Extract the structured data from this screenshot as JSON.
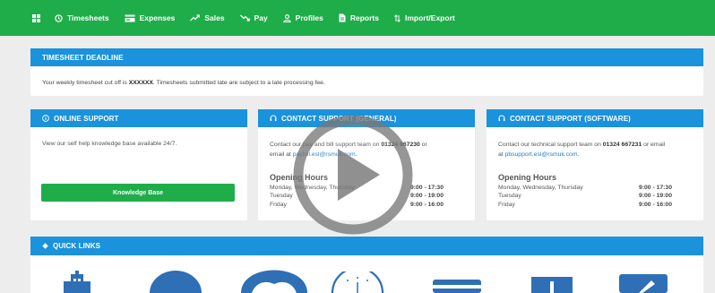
{
  "nav": {
    "items": [
      {
        "label": "Timesheets",
        "icon": "clock-icon"
      },
      {
        "label": "Expenses",
        "icon": "card-icon"
      },
      {
        "label": "Sales",
        "icon": "trend-up-icon"
      },
      {
        "label": "Pay",
        "icon": "trend-down-icon"
      },
      {
        "label": "Profiles",
        "icon": "person-icon"
      },
      {
        "label": "Reports",
        "icon": "document-icon"
      },
      {
        "label": "Import/Export",
        "icon": "sort-arrows-icon"
      }
    ]
  },
  "deadline": {
    "title": "TIMESHEET DEADLINE",
    "text_pre": "Your weekly timesheet cut off is ",
    "cutoff": "XXXXXX",
    "text_post": ". Timesheets submitted late are subject to a late processing fee."
  },
  "online_support": {
    "title": "ONLINE SUPPORT",
    "text": "View our self help knowledge base available 24/7.",
    "button": "Knowledge Base"
  },
  "contact_general": {
    "title": "CONTACT SUPPORT (GENERAL)",
    "text_pre": "Contact our pay and bill support team on ",
    "phone": "01324 667230",
    "text_mid": " or",
    "text_email_pre": "email at ",
    "email": "paybill.esl@rsmuk.com",
    "text_email_post": ".",
    "hours_title": "Opening Hours",
    "hours": [
      {
        "days": "Monday, Wednesday, Thursday",
        "time": "9:00 - 17:30"
      },
      {
        "days": "Tuesday",
        "time": "9:00 - 19:00"
      },
      {
        "days": "Friday",
        "time": "9:00 - 16:00"
      }
    ]
  },
  "contact_software": {
    "title": "CONTACT SUPPORT (SOFTWARE)",
    "text_pre": "Contact our technical support team on ",
    "phone": "01324 667231",
    "text_mid": " or email",
    "text_email_pre": "at ",
    "email": "pbsupport.esl@rsmuk.com",
    "text_email_post": ".",
    "hours_title": "Opening Hours",
    "hours": [
      {
        "days": "Monday, Wednesday, Thursday",
        "time": "9:00 - 17:30"
      },
      {
        "days": "Tuesday",
        "time": "9:00 - 19:00"
      },
      {
        "days": "Friday",
        "time": "9:00 - 16:00"
      }
    ]
  },
  "quick_links": {
    "title": "QUICK LINKS",
    "icons": [
      "building-icon",
      "person-icon",
      "person-icon",
      "clock-icon",
      "card-icon",
      "document-icon",
      "edit-icon"
    ]
  },
  "colors": {
    "nav_green": "#1fad4a",
    "panel_blue": "#1a92dc",
    "icon_blue": "#2f6fb5",
    "button_green": "#1fad4a"
  }
}
